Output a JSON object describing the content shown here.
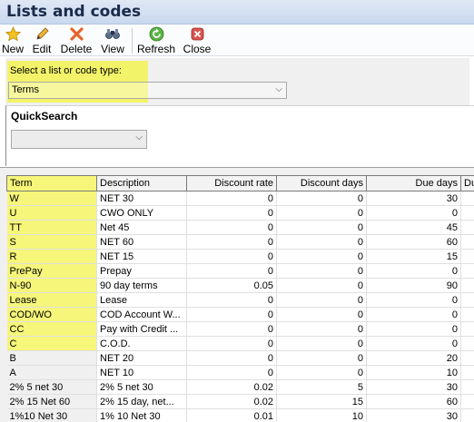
{
  "window": {
    "title": "Lists and codes"
  },
  "toolbar": {
    "new_label": "New",
    "edit_label": "Edit",
    "delete_label": "Delete",
    "view_label": "View",
    "refresh_label": "Refresh",
    "close_label": "Close"
  },
  "selector": {
    "label": "Select a list or code type:",
    "value": "Terms"
  },
  "quicksearch": {
    "title": "QuickSearch",
    "value": ""
  },
  "grid": {
    "columns": [
      "Term",
      "Description",
      "Discount rate",
      "Discount days",
      "Due days",
      "Du"
    ],
    "rows": [
      [
        "W",
        "NET 30",
        "0",
        "0",
        "30"
      ],
      [
        "U",
        "CWO ONLY",
        "0",
        "0",
        "0"
      ],
      [
        "TT",
        "Net 45",
        "0",
        "0",
        "45"
      ],
      [
        "S",
        "NET 60",
        "0",
        "0",
        "60"
      ],
      [
        "R",
        "NET 15",
        "0",
        "0",
        "15"
      ],
      [
        "PrePay",
        "Prepay",
        "0",
        "0",
        "0"
      ],
      [
        "N-90",
        "90 day terms",
        "0.05",
        "0",
        "90"
      ],
      [
        "Lease",
        "Lease",
        "0",
        "0",
        "0"
      ],
      [
        "COD/WO",
        "COD Account W...",
        "0",
        "0",
        "0"
      ],
      [
        "CC",
        "Pay with Credit ...",
        "0",
        "0",
        "0"
      ],
      [
        "C",
        "C.O.D.",
        "0",
        "0",
        "0"
      ],
      [
        "B",
        "NET 20",
        "0",
        "0",
        "20"
      ],
      [
        "A",
        "NET 10",
        "0",
        "0",
        "10"
      ],
      [
        "2% 5 net 30",
        " 2% 5 net 30",
        "0.02",
        "5",
        "30"
      ],
      [
        "2% 15 Net 60",
        "2% 15 day, net...",
        "0.02",
        "15",
        "60"
      ],
      [
        "1%10 Net 30",
        "1% 10 Net 30",
        "0.01",
        "10",
        "30"
      ]
    ]
  },
  "colors": {
    "highlight": "#f6f67a",
    "titlebar": "#c9d8ee"
  }
}
